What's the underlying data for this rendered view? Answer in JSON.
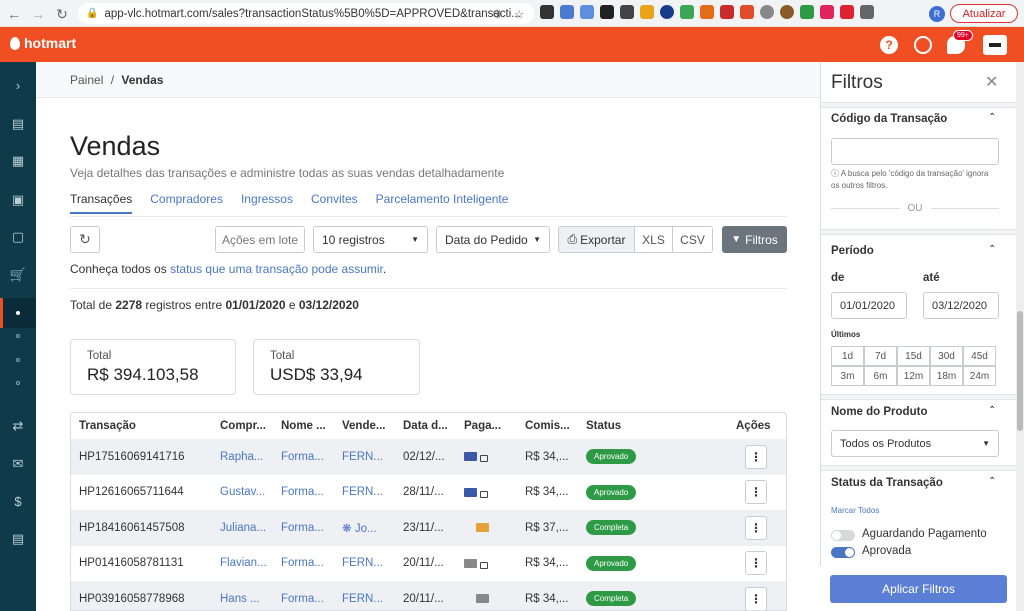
{
  "browser": {
    "url": "app-vlc.hotmart.com/sales?transactionStatus%5B0%5D=APPROVED&transacti...",
    "avatar_letter": "R",
    "update_label": "Atualizar"
  },
  "header": {
    "logo": "hotmart",
    "notification_count": "99+"
  },
  "breadcrumb": {
    "root": "Painel",
    "separator": "/",
    "current": "Vendas"
  },
  "page": {
    "title": "Vendas",
    "subtitle": "Veja detalhes das transações e administre todas as suas vendas detalhadamente"
  },
  "tabs": [
    {
      "label": "Transações",
      "active": true
    },
    {
      "label": "Compradores"
    },
    {
      "label": "Ingressos"
    },
    {
      "label": "Convites"
    },
    {
      "label": "Parcelamento Inteligente"
    }
  ],
  "toolbar": {
    "bulk_actions": "Ações em lote",
    "per_page": "10 registros",
    "date_field": "Data do Pedido",
    "export": "Exportar",
    "xls": "XLS",
    "csv": "CSV",
    "filters": "Filtros"
  },
  "info": {
    "prefix": "Conheça todos os ",
    "link": "status que uma transação pode assumir",
    "suffix": "."
  },
  "total": {
    "prefix": "Total de ",
    "count": "2278",
    "mid": " registros entre ",
    "start": "01/01/2020",
    "and": " e ",
    "end": "03/12/2020"
  },
  "summary_cards": [
    {
      "label": "Total",
      "value": "R$ 394.103,58"
    },
    {
      "label": "Total",
      "value": "USD$ 33,94"
    }
  ],
  "table": {
    "columns": [
      "Transação",
      "Compr...",
      "Nome ...",
      "Vende...",
      "Data d...",
      "Paga...",
      "Comis...",
      "Status",
      "Ações"
    ],
    "rows": [
      {
        "id": "HP17516069141716",
        "buyer": "Rapha...",
        "product": "Forma...",
        "seller": "FERN...",
        "date": "02/12/...",
        "commission": "R$ 34,...",
        "status": "Aprovado"
      },
      {
        "id": "HP12616065711644",
        "buyer": "Gustav...",
        "product": "Forma...",
        "seller": "FERN...",
        "date": "28/11/...",
        "commission": "R$ 34,...",
        "status": "Aprovado"
      },
      {
        "id": "HP18416061457508",
        "buyer": "Juliana...",
        "product": "Forma...",
        "seller": "Jo...",
        "date": "23/11/...",
        "commission": "R$ 37,...",
        "status": "Completa"
      },
      {
        "id": "HP01416058781131",
        "buyer": "Flavian...",
        "product": "Forma...",
        "seller": "FERN...",
        "date": "20/11/...",
        "commission": "R$ 34,...",
        "status": "Aprovado"
      },
      {
        "id": "HP03916058778968",
        "buyer": "Hans ...",
        "product": "Forma...",
        "seller": "FERN...",
        "date": "20/11/...",
        "commission": "R$ 34,...",
        "status": "Completa"
      }
    ]
  },
  "filters": {
    "title": "Filtros",
    "transaction_code": {
      "heading": "Código da Transação",
      "value": "",
      "hint": "ⓘ A busca pelo 'código da transação' ignora os outros filtros.",
      "or": "OU"
    },
    "period": {
      "heading": "Período",
      "from_label": "de",
      "to_label": "até",
      "from_value": "01/01/2020",
      "to_value": "03/12/2020",
      "recent_label": "Últimos",
      "ranges": [
        "1d",
        "7d",
        "15d",
        "30d",
        "45d",
        "3m",
        "6m",
        "12m",
        "18m",
        "24m"
      ]
    },
    "product": {
      "heading": "Nome do Produto",
      "selected": "Todos os Produtos"
    },
    "status": {
      "heading": "Status da Transação",
      "mark_all": "Marcar Todos",
      "options": [
        {
          "label": "Aguardando Pagamento",
          "on": false
        },
        {
          "label": "Aprovada",
          "on": true
        }
      ]
    },
    "apply": "Aplicar Filtros"
  },
  "colors": {
    "brand": "#f04e23",
    "sidebar": "#0e3a4a",
    "link": "#4a77c4",
    "status_green": "#2e9a46",
    "apply_button": "#5b7fd4"
  }
}
